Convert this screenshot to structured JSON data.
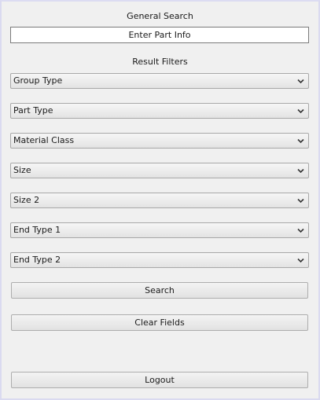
{
  "general_search": {
    "title": "General Search",
    "input_placeholder": "Enter Part Info",
    "input_value": ""
  },
  "result_filters": {
    "title": "Result Filters",
    "dropdowns": [
      {
        "id": "group-type",
        "selected": "Group Type"
      },
      {
        "id": "part-type",
        "selected": "Part Type"
      },
      {
        "id": "material-class",
        "selected": "Material Class"
      },
      {
        "id": "size",
        "selected": "Size"
      },
      {
        "id": "size-2",
        "selected": "Size 2"
      },
      {
        "id": "end-type-1",
        "selected": "End Type 1"
      },
      {
        "id": "end-type-2",
        "selected": "End Type 2"
      }
    ]
  },
  "buttons": {
    "search": "Search",
    "clear_fields": "Clear Fields",
    "logout": "Logout"
  },
  "icons": {
    "dropdown": "chevron-down-icon"
  },
  "colors": {
    "window_background": "#f0f0f0",
    "window_border": "#dadaf0"
  }
}
